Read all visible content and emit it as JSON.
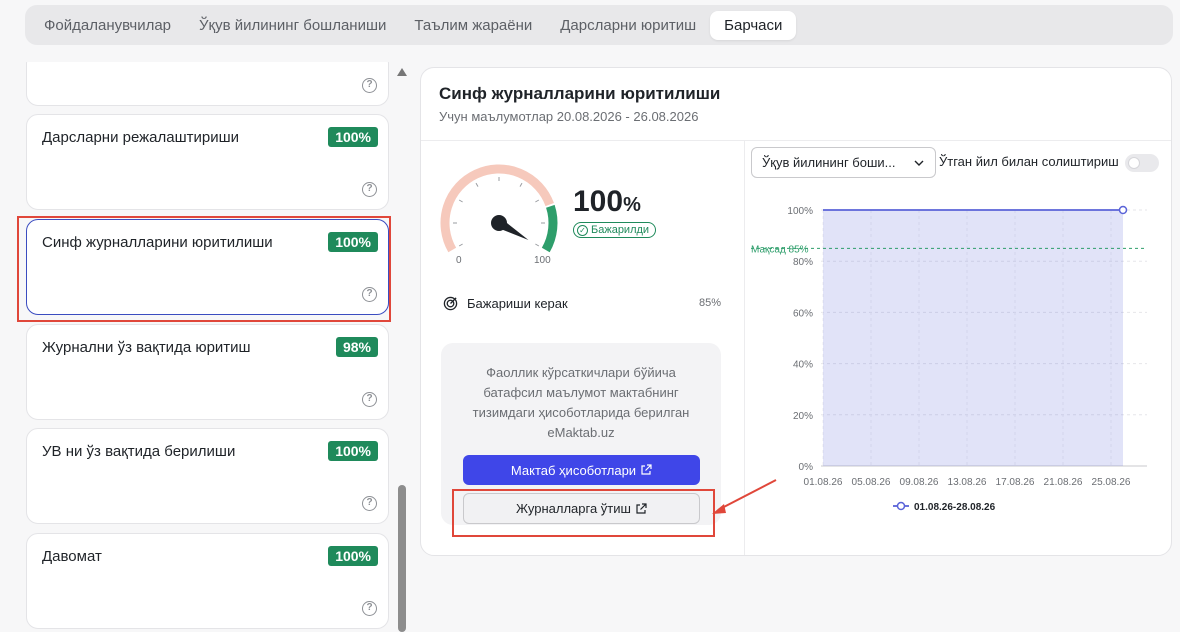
{
  "tabs": [
    {
      "label": "Фойдаланувчилар",
      "active": false
    },
    {
      "label": "Ўқув йилининг бошланиши",
      "active": false
    },
    {
      "label": "Таълим жараёни",
      "active": false
    },
    {
      "label": "Дарсларни юритиш",
      "active": false
    },
    {
      "label": "Барчаси",
      "active": true
    }
  ],
  "list": {
    "help_glyph": "?",
    "items": [
      {
        "title": "",
        "badge": ""
      },
      {
        "title": "Дарсларни режалаштириши",
        "badge": "100%"
      },
      {
        "title": "Синф журналларини юритилиши",
        "badge": "100%",
        "selected": true
      },
      {
        "title": "Журнални ўз вақтида юритиш",
        "badge": "98%"
      },
      {
        "title": "УВ ни ўз вақтида берилиши",
        "badge": "100%"
      },
      {
        "title": "Давомат",
        "badge": "100%"
      }
    ]
  },
  "panel": {
    "title": "Синф журналларини юритилиши",
    "subtitle": "Учун маълумотлар 20.08.2026 - 26.08.2026",
    "gauge": {
      "value": 100,
      "min_label": "0",
      "max_label": "100",
      "colors": {
        "track": "#f6c9bc",
        "fill": "#2e9e6b",
        "needle": "#1f2328"
      }
    },
    "value_number": "100",
    "value_unit": "%",
    "status": "Бажарилди",
    "target_label": "Бажариши керак",
    "target_value": "85%",
    "info_text": "Фаоллик кўрсаткичлари бўйича батафсил маълумот мактабнинг тизимдаги ҳисоботларида берилган eMaktab.uz",
    "primary_button": "Мактаб ҳисоботлари",
    "secondary_button": "Журналларга ўтиш",
    "period_select": "Ўқув йилининг боши...",
    "compare_label": "Ўтган йил билан солиштириш",
    "compare_toggle": false
  },
  "chart_data": {
    "type": "area",
    "x": [
      "01.08.26",
      "05.08.26",
      "09.08.26",
      "13.08.26",
      "17.08.26",
      "21.08.26",
      "25.08.26"
    ],
    "series": [
      {
        "name": "01.08.26-28.08.26",
        "values": [
          100,
          100,
          100,
          100,
          100,
          100,
          100,
          100
        ],
        "color": "#5a63d8"
      }
    ],
    "y_ticks": [
      "0%",
      "20%",
      "40%",
      "60%",
      "80%",
      "100%"
    ],
    "ylim": [
      0,
      100
    ],
    "target": {
      "label": "Мақсад 85%",
      "value": 85,
      "color": "#2e9e6b"
    },
    "grid": true,
    "legend": "bottom"
  }
}
